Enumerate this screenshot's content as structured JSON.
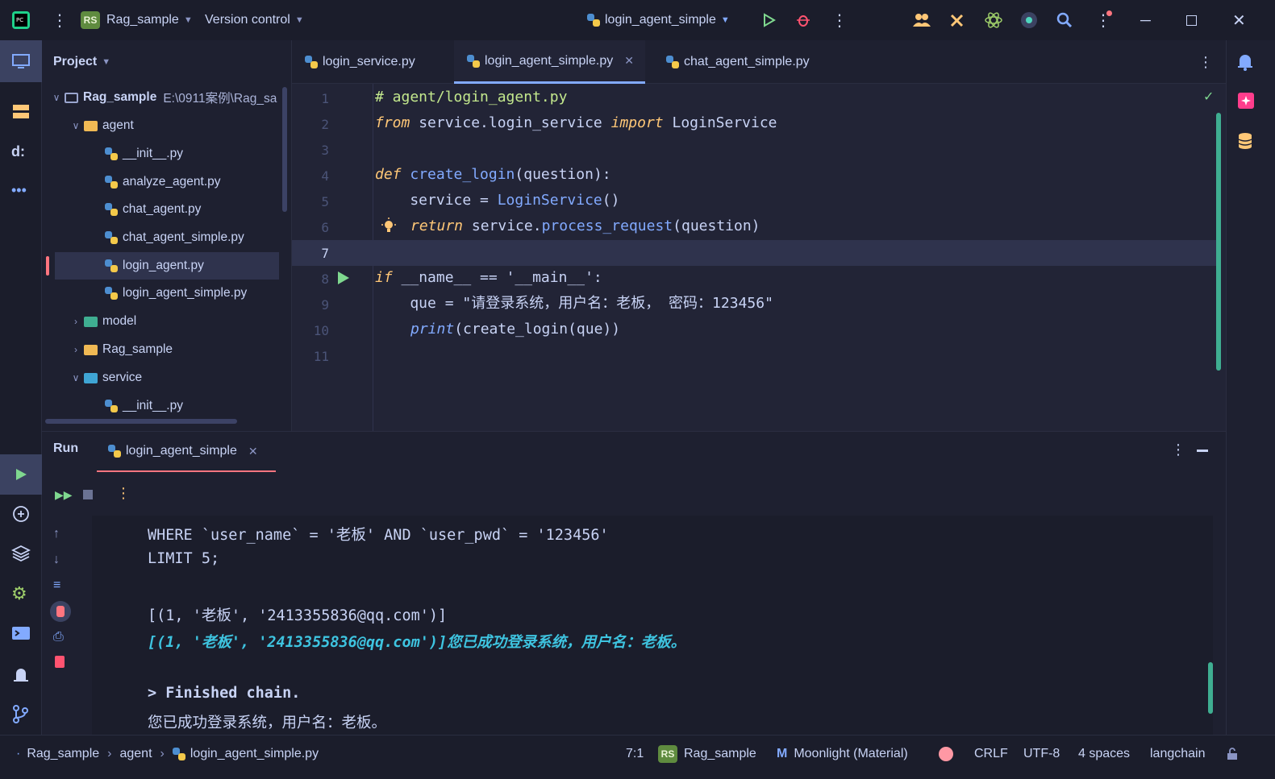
{
  "titlebar": {
    "project_badge": "RS",
    "project_name": "Rag_sample",
    "vcs_label": "Version control",
    "run_config": "login_agent_simple"
  },
  "project_panel": {
    "title": "Project",
    "root_name": "Rag_sample",
    "root_path": "E:\\0911案例\\Rag_sa",
    "items": [
      {
        "label": "agent",
        "kind": "folder"
      },
      {
        "label": "__init__.py",
        "kind": "py"
      },
      {
        "label": "analyze_agent.py",
        "kind": "py"
      },
      {
        "label": "chat_agent.py",
        "kind": "py"
      },
      {
        "label": "chat_agent_simple.py",
        "kind": "py"
      },
      {
        "label": "login_agent.py",
        "kind": "py"
      },
      {
        "label": "login_agent_simple.py",
        "kind": "py"
      },
      {
        "label": "model",
        "kind": "folder"
      },
      {
        "label": "Rag_sample",
        "kind": "folder"
      },
      {
        "label": "service",
        "kind": "folder"
      },
      {
        "label": "__init__.py",
        "kind": "py"
      }
    ]
  },
  "tabs": [
    {
      "label": "login_service.py"
    },
    {
      "label": "login_agent_simple.py"
    },
    {
      "label": "chat_agent_simple.py"
    }
  ],
  "editor": {
    "line_numbers": [
      "1",
      "2",
      "3",
      "4",
      "5",
      "6",
      "7",
      "8",
      "9",
      "10",
      "11"
    ],
    "line1": "# agent/login_agent.py",
    "line2_from": "from",
    "line2_mod": " service.login_service ",
    "line2_import": "import",
    "line2_cls": " LoginService",
    "line4_def": "def",
    "line4_name": " create_login",
    "line4_rest": "(question):",
    "line5_a": "    service = ",
    "line5_b": "LoginService",
    "line5_c": "()",
    "line6_return": "return",
    "line6_a": " service.",
    "line6_b": "process_request",
    "line6_c": "(question)",
    "line8_if": "if",
    "line8_rest": " __name__ == '__main__':",
    "line9_a": "    que = ",
    "line9_str": "\"请登录系统，用户名：老板， 密码：123456\"",
    "line10_print": "print",
    "line10_rest": "(create_login(que))"
  },
  "run": {
    "title": "Run",
    "tab_label": "login_agent_simple",
    "lines": [
      "WHERE `user_name` = '老板' AND `user_pwd` = '123456'",
      "LIMIT 5;",
      "[(1, '老板', '2413355836@qq.com')]",
      "[(1, '老板', '2413355836@qq.com')]您已成功登录系统，用户名：老板。",
      "> Finished chain.",
      "您已成功登录系统，用户名：老板。"
    ]
  },
  "status": {
    "crumbs": [
      "Rag_sample",
      "agent",
      "login_agent_simple.py"
    ],
    "position": "7:1",
    "badge": "RS",
    "project": "Rag_sample",
    "theme": "Moonlight (Material)",
    "line_sep": "CRLF",
    "encoding": "UTF-8",
    "indent": "4 spaces",
    "interpreter": "langchain"
  }
}
